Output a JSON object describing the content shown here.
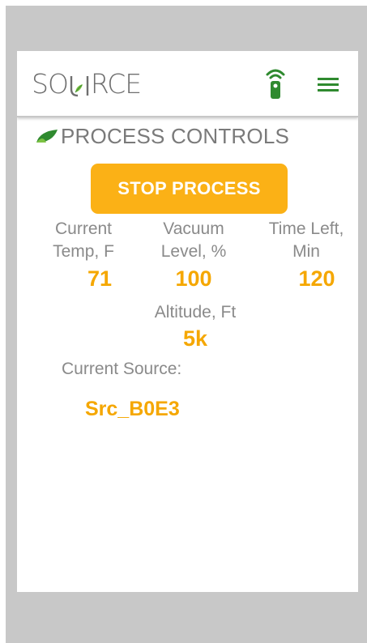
{
  "header": {
    "brand": "SOURCE",
    "icons": {
      "remote": "remote-signal-icon",
      "menu": "hamburger-menu-icon"
    },
    "colors": {
      "brand_text": "#6f6f6f",
      "accent_green": "#3a8a2e",
      "leaf_light": "#7cc243"
    }
  },
  "section": {
    "title": "PROCESS CONTROLS",
    "icon": "leaf-icon"
  },
  "controls": {
    "stop_button_label": "STOP PROCESS",
    "button_color": "#fbb116"
  },
  "stats": {
    "current_temp": {
      "label_line1": "Current",
      "label_line2": "Temp, F",
      "value": "71"
    },
    "vacuum_level": {
      "label_line1": "Vacuum",
      "label_line2": "Level, %",
      "value": "100"
    },
    "time_left": {
      "label_line1": "Time Left,",
      "label_line2": "Min",
      "value": "120"
    },
    "altitude": {
      "label": "Altitude, Ft",
      "value": "5k"
    },
    "value_color": "#f5a700"
  },
  "source": {
    "label": "Current Source:",
    "value": "Src_B0E3"
  }
}
